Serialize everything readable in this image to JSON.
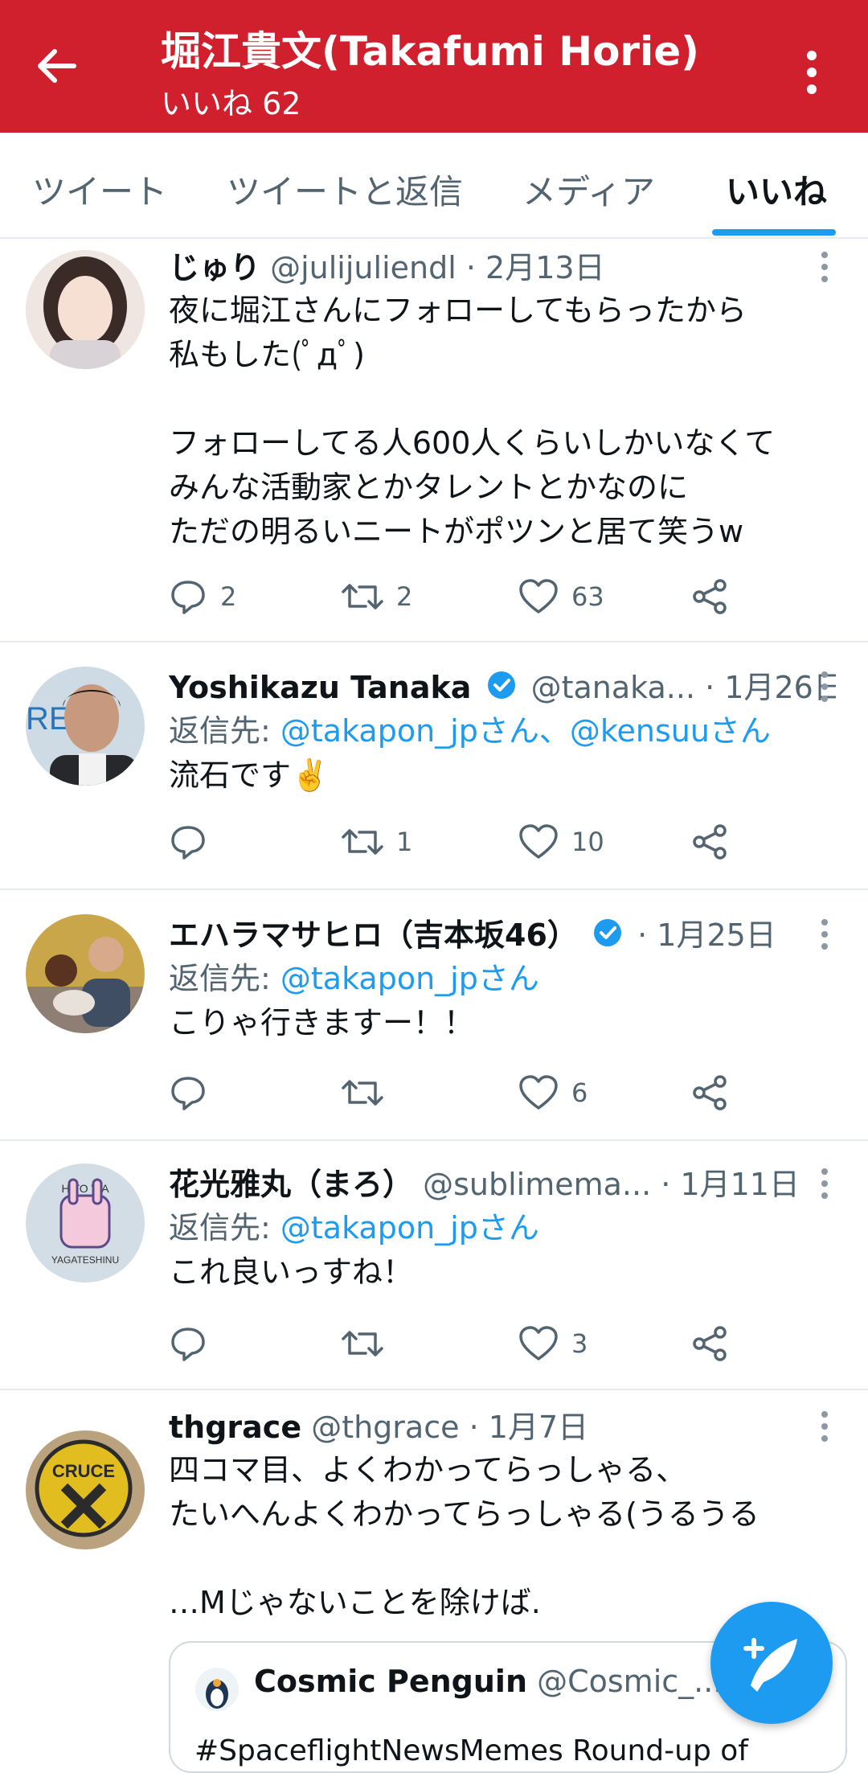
{
  "header": {
    "title": "堀江貴文(Takafumi Horie)",
    "subtitle": "いいね 62",
    "color": "#d0202e"
  },
  "tabs": [
    {
      "label": "ツイート"
    },
    {
      "label": "ツイートと返信"
    },
    {
      "label": "メディア"
    },
    {
      "label": "いいね",
      "active": true
    }
  ],
  "tweets": [
    {
      "name": "じゅり",
      "handle": "@julijuliendl",
      "sep": "·",
      "date": "2月13日",
      "text": "夜に堀江さんにフォローしてもらったから\n私もした(ﾟдﾟ)\n\nフォローしてる人600人くらいしかいなくて\nみんな活動家とかタレントとかなのに\nただの明るいニートがポツンと居て笑うw",
      "replies": "2",
      "retweets": "2",
      "likes": "63"
    },
    {
      "name": "Yoshikazu Tanaka",
      "handle": "@tanaka...",
      "sep": "·",
      "date": "1月26日",
      "reply_prefix": "返信先:",
      "reply_to": "@takapon_jpさん、@kensuuさん",
      "text": "流石です✌️",
      "replies": "",
      "retweets": "1",
      "likes": "10"
    },
    {
      "name": "エハラマサヒロ（吉本坂46）",
      "handle": "",
      "sep": "·",
      "date": "1月25日",
      "reply_prefix": "返信先:",
      "reply_to": "@takapon_jpさん",
      "text": "こりゃ行きますー！！",
      "replies": "",
      "retweets": "",
      "likes": "6"
    },
    {
      "name": "花光雅丸（まろ）",
      "handle": "@sublimema...",
      "sep": "·",
      "date": "1月11日",
      "reply_prefix": "返信先:",
      "reply_to": "@takapon_jpさん",
      "text": "これ良いっすね！",
      "replies": "",
      "retweets": "",
      "likes": "3"
    },
    {
      "name": "thgrace",
      "handle": "@thgrace",
      "sep": "·",
      "date": "1月7日",
      "text": "四コマ目、よくわかってらっしゃる、\nたいへんよくわかってらっしゃる(うるうる\n\n…Mじゃないことを除けば.",
      "quote": {
        "name": "Cosmic Penguin",
        "handle": "@Cosmic_...",
        "sep": "·",
        "text": "#SpaceflightNewsMemes Round-up of"
      }
    }
  ],
  "avatar_labels": {
    "hito_wa": "HITO WA",
    "yagateshinu": "YAGATESHINU",
    "cruce": "CRUCE",
    "re": "RE"
  },
  "colors": {
    "accent": "#1d9bf0",
    "text": "#0f1419",
    "muted": "#536471",
    "divider": "#e6ecf0"
  }
}
